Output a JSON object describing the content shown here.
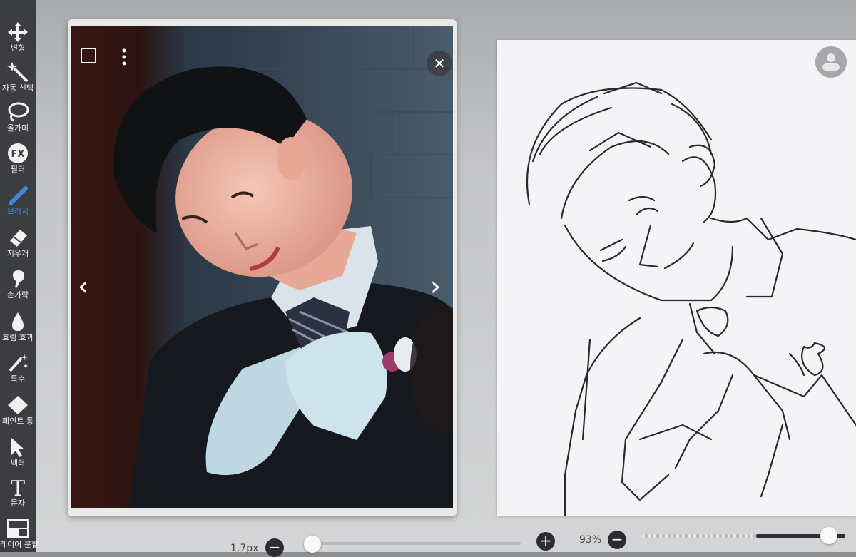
{
  "toolbar": {
    "items": [
      {
        "label": "변형",
        "icon": "move-arrows-icon",
        "active": false
      },
      {
        "label": "자동 선택",
        "icon": "magic-wand-icon",
        "active": false
      },
      {
        "label": "올가미",
        "icon": "lasso-icon",
        "active": false
      },
      {
        "label": "필터",
        "icon": "fx-icon",
        "active": false
      },
      {
        "label": "브러시",
        "icon": "brush-icon",
        "active": true
      },
      {
        "label": "지우개",
        "icon": "eraser-icon",
        "active": false
      },
      {
        "label": "손가락",
        "icon": "finger-icon",
        "active": false
      },
      {
        "label": "흐림 효과",
        "icon": "drop-icon",
        "active": false
      },
      {
        "label": "특수",
        "icon": "sparkle-pen-icon",
        "active": false
      },
      {
        "label": "페인트 통",
        "icon": "paint-bucket-icon",
        "active": false
      },
      {
        "label": "벡터",
        "icon": "vector-arrow-icon",
        "active": false
      },
      {
        "label": "문자",
        "icon": "text-icon",
        "active": false
      },
      {
        "label": "레이어 분할",
        "icon": "frame-divider-icon",
        "active": false
      }
    ],
    "active_color": "#3e8ad8"
  },
  "reference_window": {
    "prev_icon": "‹",
    "next_icon": "›",
    "close_icon": "✕"
  },
  "bottom_bar": {
    "brush_size": "1.7px",
    "zoom": "93%",
    "minus_symbol": "−",
    "plus_symbol": "+"
  }
}
